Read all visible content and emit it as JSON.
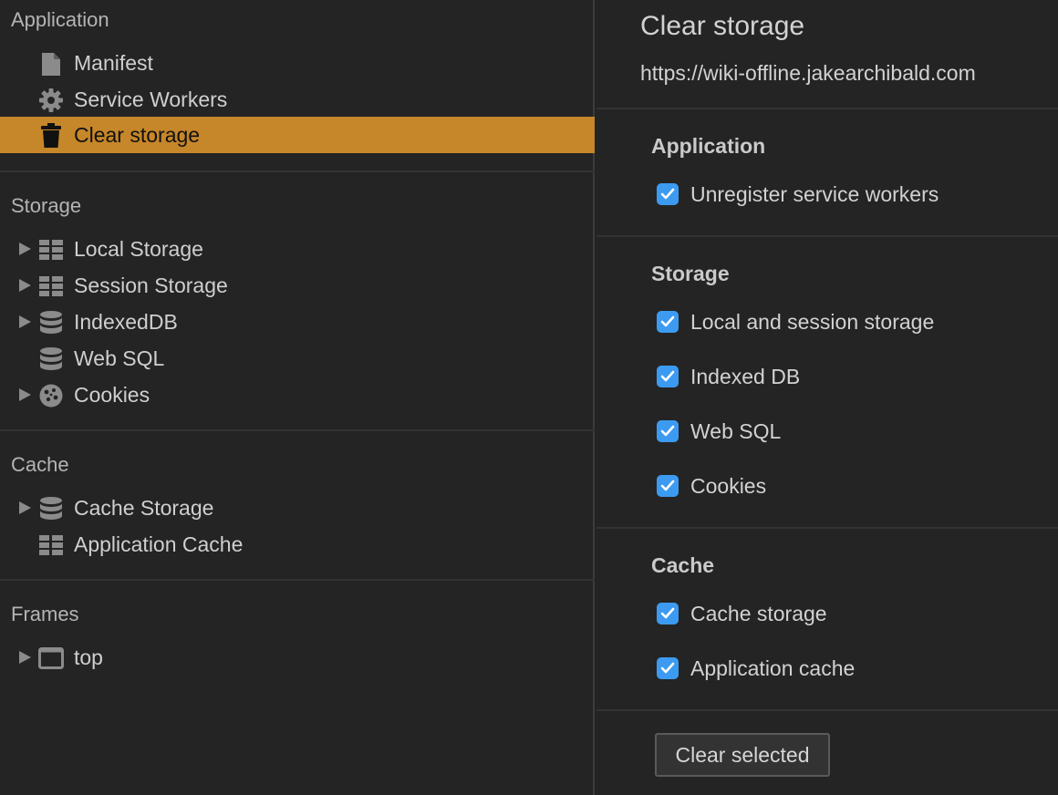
{
  "sidebar": {
    "sections": {
      "application": "Application",
      "storage": "Storage",
      "cache": "Cache",
      "frames": "Frames"
    },
    "items": {
      "manifest": "Manifest",
      "service_workers": "Service Workers",
      "clear_storage": "Clear storage",
      "local_storage": "Local Storage",
      "session_storage": "Session Storage",
      "indexeddb": "IndexedDB",
      "web_sql": "Web SQL",
      "cookies": "Cookies",
      "cache_storage": "Cache Storage",
      "application_cache": "Application Cache",
      "top": "top"
    },
    "selected_item": "Clear storage",
    "selected_color": "#c6862a",
    "icons": {
      "manifest": "document-icon",
      "service_workers": "gear-icon",
      "clear_storage": "trash-icon",
      "local_storage": "grid-icon",
      "session_storage": "grid-icon",
      "indexeddb": "database-icon",
      "web_sql": "database-icon",
      "cookies": "cookie-icon",
      "cache_storage": "database-icon",
      "application_cache": "grid-icon",
      "top": "frame-icon"
    }
  },
  "main": {
    "title": "Clear storage",
    "origin": "https://wiki-offline.jakearchibald.com",
    "groups": {
      "application": {
        "title": "Application",
        "options": [
          {
            "label": "Unregister service workers",
            "checked": true
          }
        ]
      },
      "storage": {
        "title": "Storage",
        "options": [
          {
            "label": "Local and session storage",
            "checked": true
          },
          {
            "label": "Indexed DB",
            "checked": true
          },
          {
            "label": "Web SQL",
            "checked": true
          },
          {
            "label": "Cookies",
            "checked": true
          }
        ]
      },
      "cache": {
        "title": "Cache",
        "options": [
          {
            "label": "Cache storage",
            "checked": true
          },
          {
            "label": "Application cache",
            "checked": true
          }
        ]
      }
    },
    "clear_button": "Clear selected",
    "checkbox_color": "#3c9bf0"
  }
}
